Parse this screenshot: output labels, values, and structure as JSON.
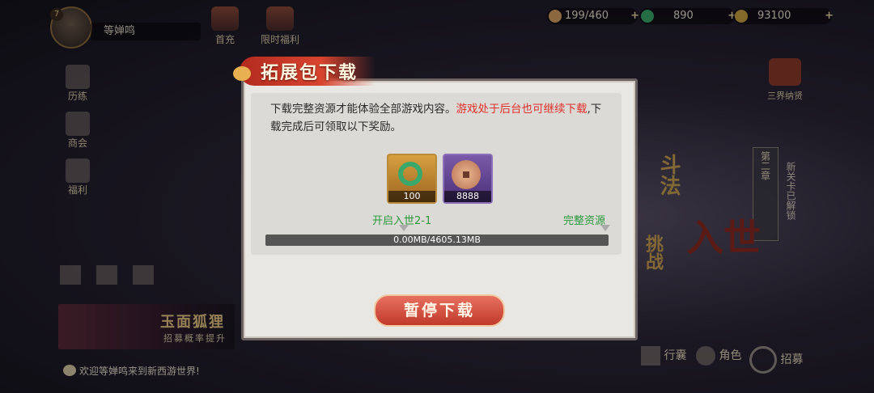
{
  "player": {
    "level": "7",
    "name": "等婵鸣"
  },
  "top_buttons": [
    {
      "label": "首充"
    },
    {
      "label": "限时福利"
    }
  ],
  "currencies": [
    {
      "value": "199/460",
      "color": "#d8a060",
      "icon": "stamina-icon"
    },
    {
      "value": "890",
      "color": "#3aa86a",
      "icon": "jade-icon"
    },
    {
      "value": "93100",
      "color": "#c8a040",
      "icon": "coin-icon"
    }
  ],
  "side_menu": [
    {
      "label": "历练"
    },
    {
      "label": "商会"
    },
    {
      "label": "福利"
    }
  ],
  "right_menu": {
    "label": "三界纳贤"
  },
  "chapter": {
    "label": "第二章",
    "note": "新关卡已解锁"
  },
  "bg_text": {
    "fight": "斗法",
    "challenge": "挑战",
    "enter": "入世"
  },
  "banner": {
    "title": "玉面狐狸",
    "subtitle": "招募概率提升"
  },
  "welcome": "欢迎等婵鸣来到新西游世界!",
  "bottom_menu": [
    {
      "label": "行囊"
    },
    {
      "label": "角色"
    },
    {
      "label": "招募"
    }
  ],
  "dialog": {
    "title": "拓展包下载",
    "desc_normal": "下载完整资源才能体验全部游戏内容。",
    "desc_highlight": "游戏处于后台也可继续下载",
    "desc_tail": ",下载完成后可领取以下奖励。",
    "rewards": [
      {
        "icon": "jade-ring-icon",
        "qty": "100"
      },
      {
        "icon": "copper-coin-icon",
        "qty": "8888"
      }
    ],
    "milestone_left": "开启入世2-1",
    "milestone_right": "完整资源",
    "progress": {
      "fraction": 0,
      "text": "0.00MB/4605.13MB"
    },
    "pause_label": "暂停下载"
  }
}
